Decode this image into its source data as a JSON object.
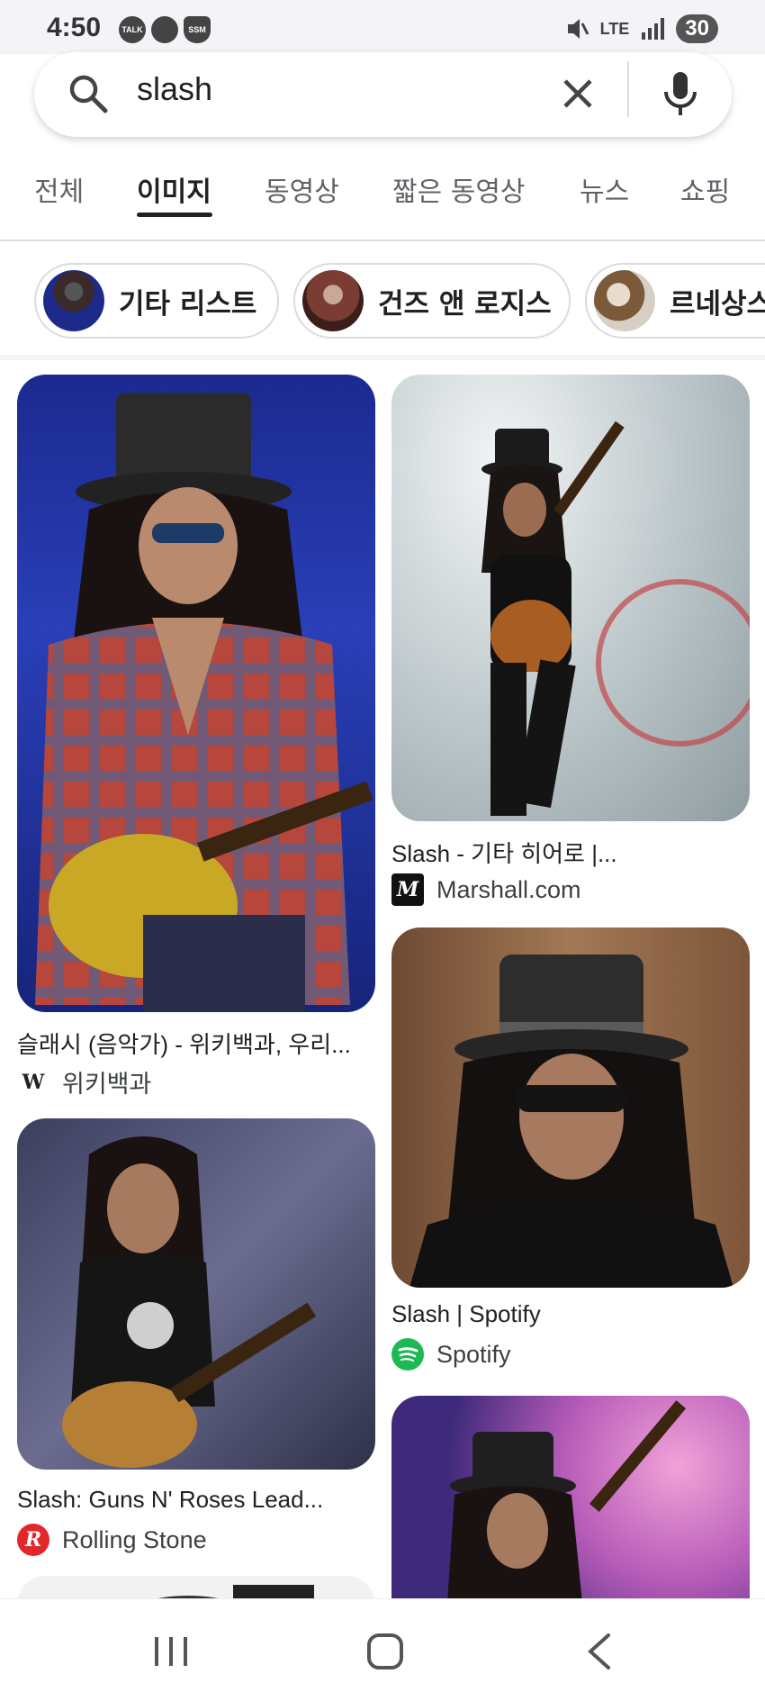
{
  "status_bar": {
    "time": "4:50",
    "left_icons": [
      "TALK",
      "",
      "SSM"
    ],
    "network": "LTE",
    "battery": "30"
  },
  "search": {
    "query": "slash"
  },
  "tabs": [
    {
      "label": "전체"
    },
    {
      "label": "이미지"
    },
    {
      "label": "동영상"
    },
    {
      "label": "짧은 동영상"
    },
    {
      "label": "뉴스"
    },
    {
      "label": "쇼핑"
    }
  ],
  "chips": [
    {
      "label": "기타 리스트"
    },
    {
      "label": "건즈 앤 로지스"
    },
    {
      "label": "르네상스"
    }
  ],
  "results": [
    {
      "caption": "슬래시 (음악가) - 위키백과, 우리...",
      "source": "위키백과",
      "logo": "W"
    },
    {
      "caption": "Slash - 기타 히어로 |...",
      "source": "Marshall.com",
      "logo": "M"
    },
    {
      "caption": "Slash | Spotify",
      "source": "Spotify",
      "logo": ""
    },
    {
      "caption": "Slash: Guns N' Roses Lead...",
      "source": "Rolling Stone",
      "logo": "R"
    }
  ],
  "colors": {
    "accent": "#202124",
    "spotify": "#1db954",
    "rolling_stone": "#e3262b",
    "marshall": "#111111"
  }
}
